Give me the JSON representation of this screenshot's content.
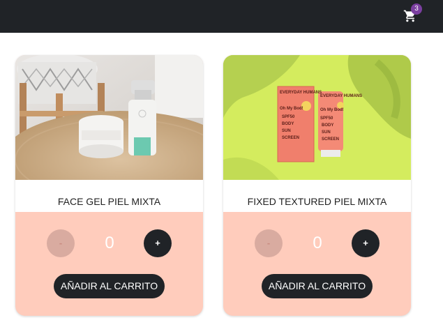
{
  "navbar": {
    "cart_icon": "shopping-cart-icon",
    "cart_count": "3",
    "background": "#202327",
    "badge_color": "#7b3fa0"
  },
  "products": [
    {
      "name": "FACE GEL PIEL MIXTA",
      "quantity": "0",
      "minus_label": "-",
      "plus_label": "+",
      "add_label": "AÑADIR AL CARRITO"
    },
    {
      "name": "FIXED TEXTURED PIEL MIXTA",
      "quantity": "0",
      "minus_label": "-",
      "plus_label": "+",
      "add_label": "AÑADIR AL CARRITO",
      "image_text": [
        "EVERYDAY HUMANS",
        "Oh My Bod!",
        "SPF50",
        "BODY",
        "SUN",
        "SCREEN"
      ]
    }
  ],
  "colors": {
    "card_bg": "#ffccbc",
    "button_dark": "#202327",
    "minus_bg": "#d9aba0"
  }
}
